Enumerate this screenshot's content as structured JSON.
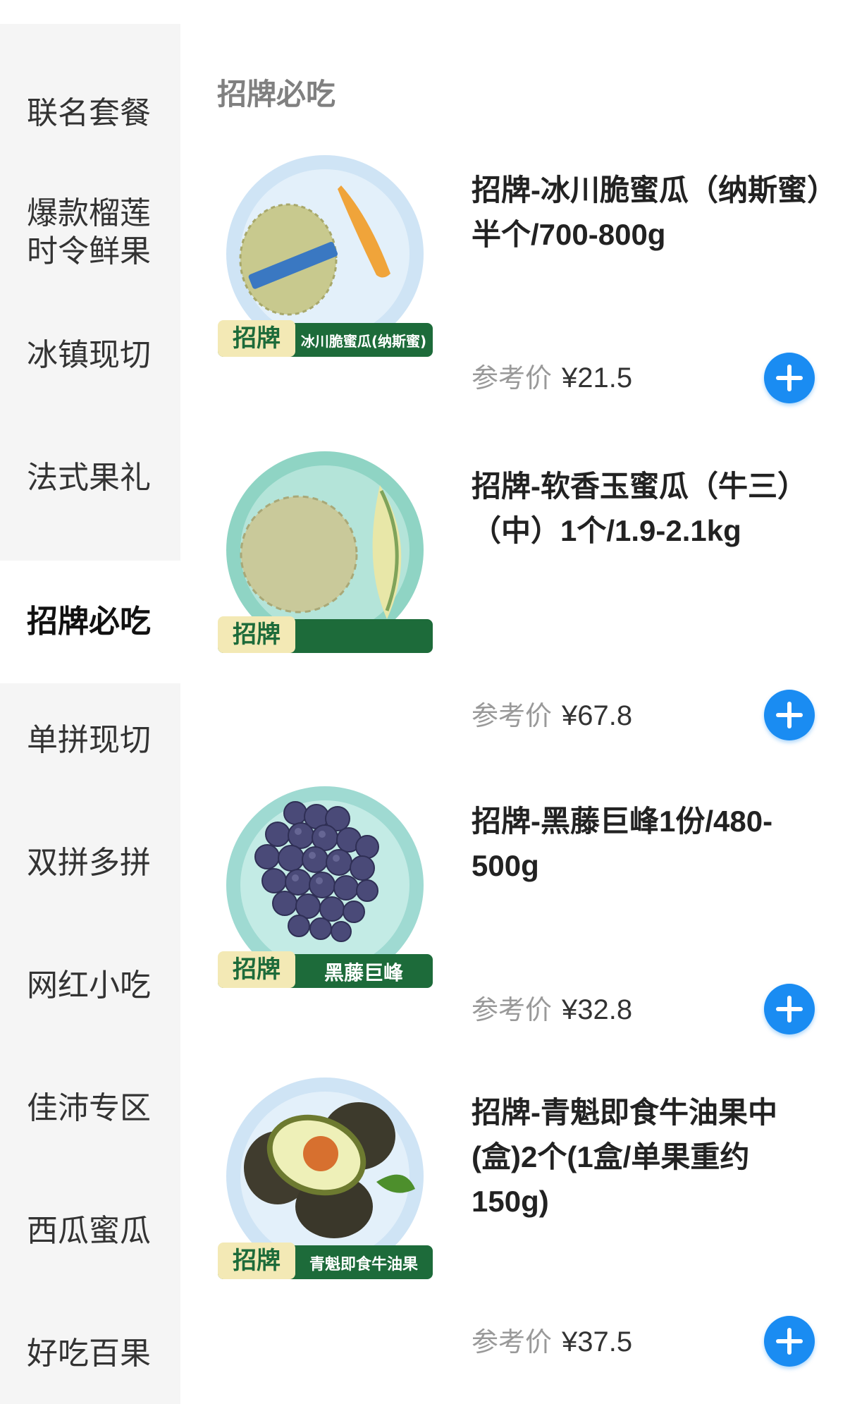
{
  "sidebar": {
    "items": [
      {
        "label": "联名套餐"
      },
      {
        "label": "爆款榴莲\n时令鲜果"
      },
      {
        "label": "冰镇现切"
      },
      {
        "label": "法式果礼"
      },
      {
        "label": "招牌必吃",
        "active": true
      },
      {
        "label": "单拼现切"
      },
      {
        "label": "双拼多拼"
      },
      {
        "label": "网红小吃"
      },
      {
        "label": "佳沛专区"
      },
      {
        "label": "西瓜蜜瓜"
      },
      {
        "label": "好吃百果"
      }
    ]
  },
  "main": {
    "section_title": "招牌必吃",
    "products": [
      {
        "name": "招牌-冰川脆蜜瓜（纳斯蜜）半个/700-800g",
        "badge": "招牌",
        "ribbon": "冰川脆蜜瓜(纳斯蜜)",
        "price_label": "参考价",
        "price": "¥21.5",
        "image": "melon-half-icon"
      },
      {
        "name": "招牌-软香玉蜜瓜（牛三）（中）1个/1.9-2.1kg",
        "badge": "招牌",
        "ribbon": "",
        "price_label": "参考价",
        "price": "¥67.8",
        "image": "melon-whole-icon"
      },
      {
        "name": "招牌-黑藤巨峰1份/480-500g",
        "badge": "招牌",
        "ribbon": "黑藤巨峰",
        "price_label": "参考价",
        "price": "¥32.8",
        "image": "grapes-icon"
      },
      {
        "name": "招牌-青魁即食牛油果中(盒)2个(1盒/单果重约150g)",
        "badge": "招牌",
        "ribbon": "青魁即食牛油果",
        "price_label": "参考价",
        "price": "¥37.5",
        "image": "avocado-icon"
      }
    ]
  },
  "colors": {
    "accent_blue": "#1a8cf2",
    "badge_green": "#1d6b3a",
    "badge_yellow": "#f3e9b5",
    "sidebar_bg": "#f5f5f5"
  }
}
